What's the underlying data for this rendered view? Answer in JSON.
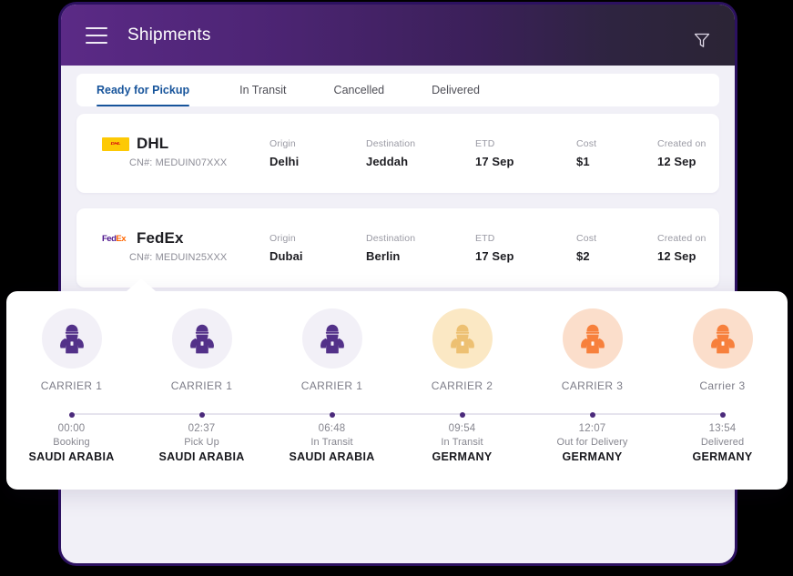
{
  "header": {
    "title": "Shipments",
    "menu_icon": "hamburger-menu-icon",
    "filter_icon": "filter-funnel-icon"
  },
  "tabs": [
    {
      "label": "Ready for Pickup",
      "active": true
    },
    {
      "label": "In Transit",
      "active": false
    },
    {
      "label": "Cancelled",
      "active": false
    },
    {
      "label": "Delivered",
      "active": false
    }
  ],
  "field_labels": {
    "origin": "Origin",
    "destination": "Destination",
    "etd": "ETD",
    "cost": "Cost",
    "created_on": "Created on"
  },
  "shipments": [
    {
      "carrier": "DHL",
      "logo": "dhl-logo",
      "cn": "CN#: MEDUIN07XXX",
      "origin": "Delhi",
      "destination": "Jeddah",
      "etd": "17 Sep",
      "cost": "$1",
      "created_on": "12 Sep"
    },
    {
      "carrier": "FedEx",
      "logo": "fedex-logo",
      "cn": "CN#: MEDUIN25XXX",
      "origin": "Dubai",
      "destination": "Berlin",
      "etd": "17 Sep",
      "cost": "$2",
      "created_on": "12 Sep"
    }
  ],
  "timeline": {
    "steps": [
      {
        "carrier": "CARRIER 1",
        "time": "00:00",
        "status": "Booking",
        "country": "SAUDI ARABIA",
        "avatar_bg": "#f2f0f7",
        "avatar_fg": "#533189"
      },
      {
        "carrier": "CARRIER 1",
        "time": "02:37",
        "status": "Pick Up",
        "country": "SAUDI ARABIA",
        "avatar_bg": "#f2f0f7",
        "avatar_fg": "#533189"
      },
      {
        "carrier": "CARRIER 1",
        "time": "06:48",
        "status": "In Transit",
        "country": "SAUDI ARABIA",
        "avatar_bg": "#f2f0f7",
        "avatar_fg": "#533189"
      },
      {
        "carrier": "CARRIER 2",
        "time": "09:54",
        "status": "In Transit",
        "country": "GERMANY",
        "avatar_bg": "#fbe8c4",
        "avatar_fg": "#edc072"
      },
      {
        "carrier": "CARRIER 3",
        "time": "12:07",
        "status": "Out for Delivery",
        "country": "GERMANY",
        "avatar_bg": "#fbdecb",
        "avatar_fg": "#f7803c"
      },
      {
        "carrier": "Carrier 3",
        "time": "13:54",
        "status": "Delivered",
        "country": "GERMANY",
        "avatar_bg": "#fbdecb",
        "avatar_fg": "#f7803c"
      }
    ],
    "avatar_icon": "delivery-person-icon",
    "dot_color": "#4b2a7b",
    "rail_color": "#e6e4ee"
  },
  "theme": {
    "frame_color": "#2c1160",
    "screen_bg": "#f1f0f7",
    "header_gradient_start": "#5b2a86",
    "header_gradient_end": "#2b2435",
    "active_tab_color": "#17549b"
  }
}
